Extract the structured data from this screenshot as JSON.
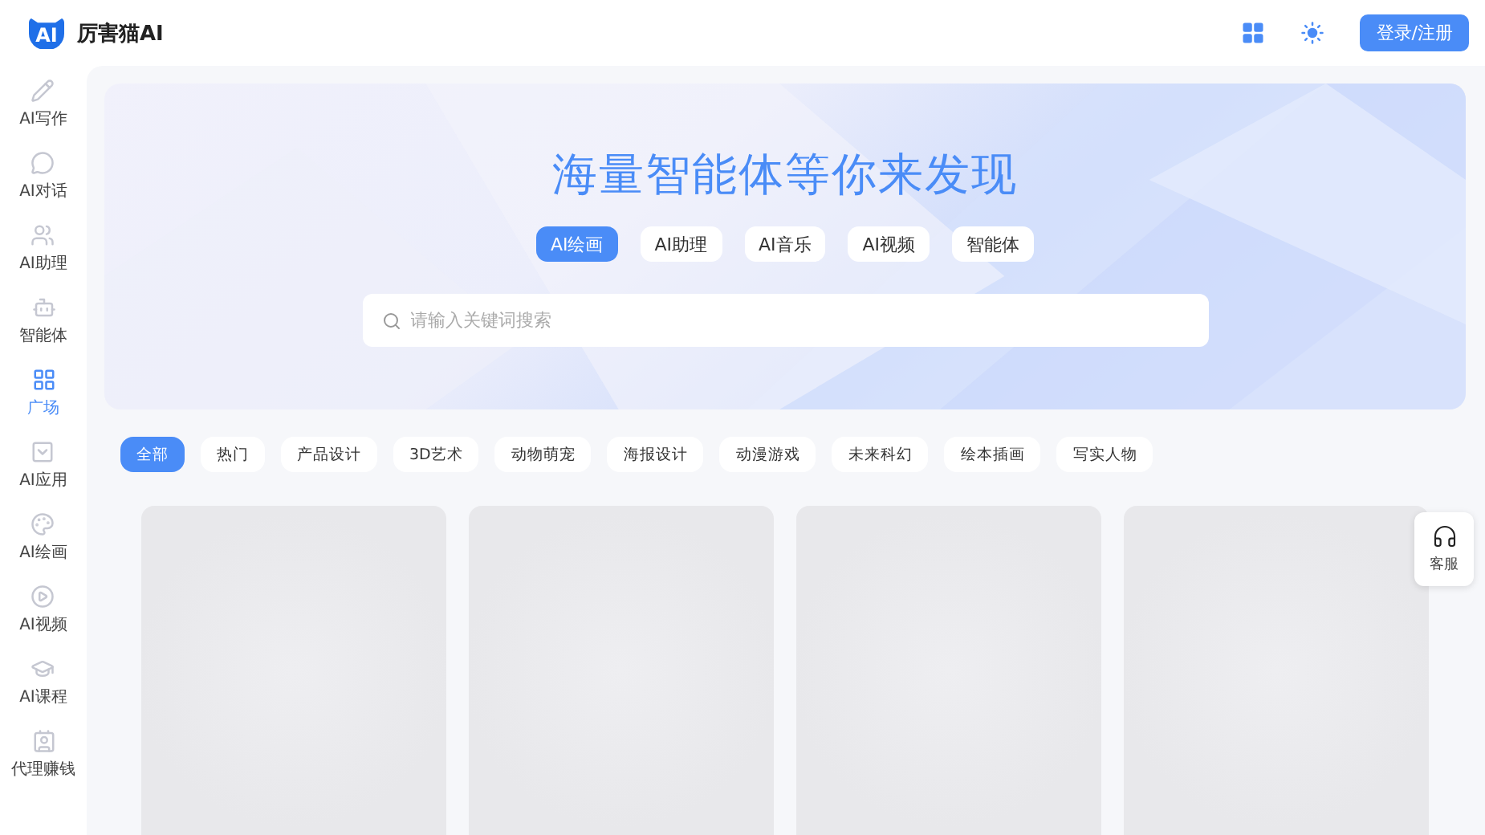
{
  "header": {
    "logo_mark": "AI",
    "brand": "厉害猫AI",
    "login_button": "登录/注册"
  },
  "sidebar": {
    "items": [
      {
        "kind": "write",
        "label": "AI写作",
        "selected": false
      },
      {
        "kind": "chat",
        "label": "AI对话",
        "selected": false
      },
      {
        "kind": "assistant",
        "label": "AI助理",
        "selected": false
      },
      {
        "kind": "agent",
        "label": "智能体",
        "selected": false
      },
      {
        "kind": "plaza",
        "label": "广场",
        "selected": true
      },
      {
        "kind": "apps",
        "label": "AI应用",
        "selected": false
      },
      {
        "kind": "paint",
        "label": "AI绘画",
        "selected": false
      },
      {
        "kind": "video",
        "label": "AI视频",
        "selected": false
      },
      {
        "kind": "course",
        "label": "AI课程",
        "selected": false
      },
      {
        "kind": "agency",
        "label": "代理赚钱",
        "selected": false
      }
    ]
  },
  "banner": {
    "title": "海量智能体等你来发现",
    "tabs": [
      {
        "label": "AI绘画",
        "selected": true
      },
      {
        "label": "AI助理",
        "selected": false
      },
      {
        "label": "AI音乐",
        "selected": false
      },
      {
        "label": "AI视频",
        "selected": false
      },
      {
        "label": "智能体",
        "selected": false
      }
    ],
    "search": {
      "placeholder": "请输入关键词搜索"
    }
  },
  "categories": [
    {
      "label": "全部",
      "selected": true
    },
    {
      "label": "热门",
      "selected": false
    },
    {
      "label": "产品设计",
      "selected": false
    },
    {
      "label": "3D艺术",
      "selected": false
    },
    {
      "label": "动物萌宠",
      "selected": false
    },
    {
      "label": "海报设计",
      "selected": false
    },
    {
      "label": "动漫游戏",
      "selected": false
    },
    {
      "label": "未来科幻",
      "selected": false
    },
    {
      "label": "绘本插画",
      "selected": false
    },
    {
      "label": "写实人物",
      "selected": false
    }
  ],
  "cards": [
    {
      "kind": "loading"
    },
    {
      "kind": "loading"
    },
    {
      "kind": "loading"
    },
    {
      "kind": "loading"
    }
  ],
  "service_button": {
    "label": "客服"
  }
}
